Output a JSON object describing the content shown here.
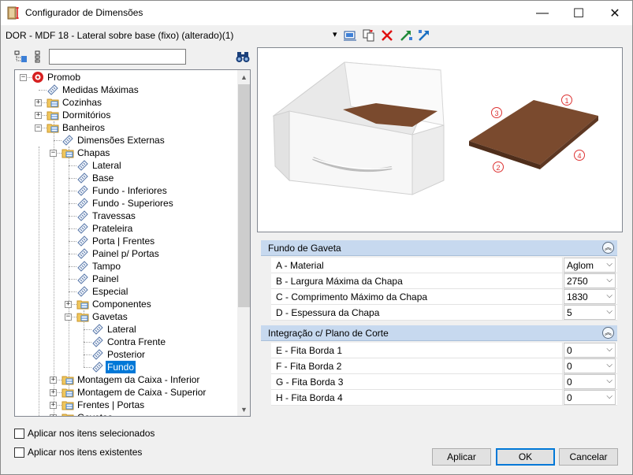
{
  "window": {
    "title": "Configurador de Dimensões",
    "minimize": "—",
    "maximize": "☐",
    "close": "✕"
  },
  "path_label": "DOR - MDF 18 - Lateral sobre base (fixo) (alterado)(1)",
  "toolbar": {
    "dropdown_glyph": "▾",
    "icons": [
      "select-dimension-icon",
      "copy-icon",
      "delete-icon",
      "import-icon",
      "export-icon"
    ]
  },
  "search": {
    "value": "",
    "placeholder": ""
  },
  "tree": [
    {
      "label": "Promob",
      "level": 0,
      "exp": "−",
      "icon": "promob"
    },
    {
      "label": "Medidas Máximas",
      "level": 1,
      "exp": "",
      "icon": "tag"
    },
    {
      "label": "Cozinhas",
      "level": 1,
      "exp": "+",
      "icon": "folder"
    },
    {
      "label": "Dormitórios",
      "level": 1,
      "exp": "+",
      "icon": "folder"
    },
    {
      "label": "Banheiros",
      "level": 1,
      "exp": "−",
      "icon": "folder"
    },
    {
      "label": "Dimensões Externas",
      "level": 2,
      "exp": "",
      "icon": "tag"
    },
    {
      "label": "Chapas",
      "level": 2,
      "exp": "−",
      "icon": "folder"
    },
    {
      "label": "Lateral",
      "level": 3,
      "exp": "",
      "icon": "tag"
    },
    {
      "label": "Base",
      "level": 3,
      "exp": "",
      "icon": "tag"
    },
    {
      "label": "Fundo - Inferiores",
      "level": 3,
      "exp": "",
      "icon": "tag"
    },
    {
      "label": "Fundo - Superiores",
      "level": 3,
      "exp": "",
      "icon": "tag"
    },
    {
      "label": "Travessas",
      "level": 3,
      "exp": "",
      "icon": "tag"
    },
    {
      "label": "Prateleira",
      "level": 3,
      "exp": "",
      "icon": "tag"
    },
    {
      "label": "Porta | Frentes",
      "level": 3,
      "exp": "",
      "icon": "tag"
    },
    {
      "label": "Painel p/ Portas",
      "level": 3,
      "exp": "",
      "icon": "tag"
    },
    {
      "label": "Tampo",
      "level": 3,
      "exp": "",
      "icon": "tag"
    },
    {
      "label": "Painel",
      "level": 3,
      "exp": "",
      "icon": "tag"
    },
    {
      "label": "Especial",
      "level": 3,
      "exp": "",
      "icon": "tag"
    },
    {
      "label": "Componentes",
      "level": 3,
      "exp": "+",
      "icon": "folder"
    },
    {
      "label": "Gavetas",
      "level": 3,
      "exp": "−",
      "icon": "folder"
    },
    {
      "label": "Lateral",
      "level": 4,
      "exp": "",
      "icon": "tag"
    },
    {
      "label": "Contra Frente",
      "level": 4,
      "exp": "",
      "icon": "tag"
    },
    {
      "label": "Posterior",
      "level": 4,
      "exp": "",
      "icon": "tag"
    },
    {
      "label": "Fundo",
      "level": 4,
      "exp": "",
      "icon": "tag",
      "selected": true
    },
    {
      "label": "Montagem da Caixa - Inferior",
      "level": 2,
      "exp": "+",
      "icon": "folder"
    },
    {
      "label": "Montagem de Caixa - Superior",
      "level": 2,
      "exp": "+",
      "icon": "folder"
    },
    {
      "label": "Frentes | Portas",
      "level": 2,
      "exp": "+",
      "icon": "folder"
    },
    {
      "label": "Gavetas",
      "level": 2,
      "exp": "+",
      "icon": "folder"
    }
  ],
  "scrollbar": {
    "up": "▲",
    "down": "▼"
  },
  "preview": {
    "markers": [
      "1",
      "2",
      "3",
      "4"
    ],
    "colors": {
      "wood": "#7a4a2e",
      "box": "#f2f2f2"
    }
  },
  "sections": [
    {
      "title": "Fundo de Gaveta",
      "rows": [
        {
          "label": "A - Material",
          "value": "Aglom"
        },
        {
          "label": "B - Largura Máxima da Chapa",
          "value": "2750"
        },
        {
          "label": "C - Comprimento Máximo da Chapa",
          "value": "1830"
        },
        {
          "label": "D - Espessura da Chapa",
          "value": "5"
        }
      ]
    },
    {
      "title": "Integração c/ Plano de Corte",
      "rows": [
        {
          "label": "E - Fita Borda 1",
          "value": "0"
        },
        {
          "label": "F - Fita Borda 2",
          "value": "0"
        },
        {
          "label": "G - Fita Borda 3",
          "value": "0"
        },
        {
          "label": "H - Fita Borda 4",
          "value": "0"
        }
      ]
    }
  ],
  "collapse_glyph": "︽",
  "combo_arrow": "⌵",
  "checkboxes": [
    {
      "label": "Aplicar nos itens selecionados",
      "checked": false
    },
    {
      "label": "Aplicar nos itens existentes",
      "checked": false
    }
  ],
  "buttons": {
    "apply": "Aplicar",
    "ok": "OK",
    "cancel": "Cancelar"
  },
  "colors": {
    "accent": "#0078d7",
    "section_header": "#c7d9ef",
    "folder": "#f0c75e"
  }
}
